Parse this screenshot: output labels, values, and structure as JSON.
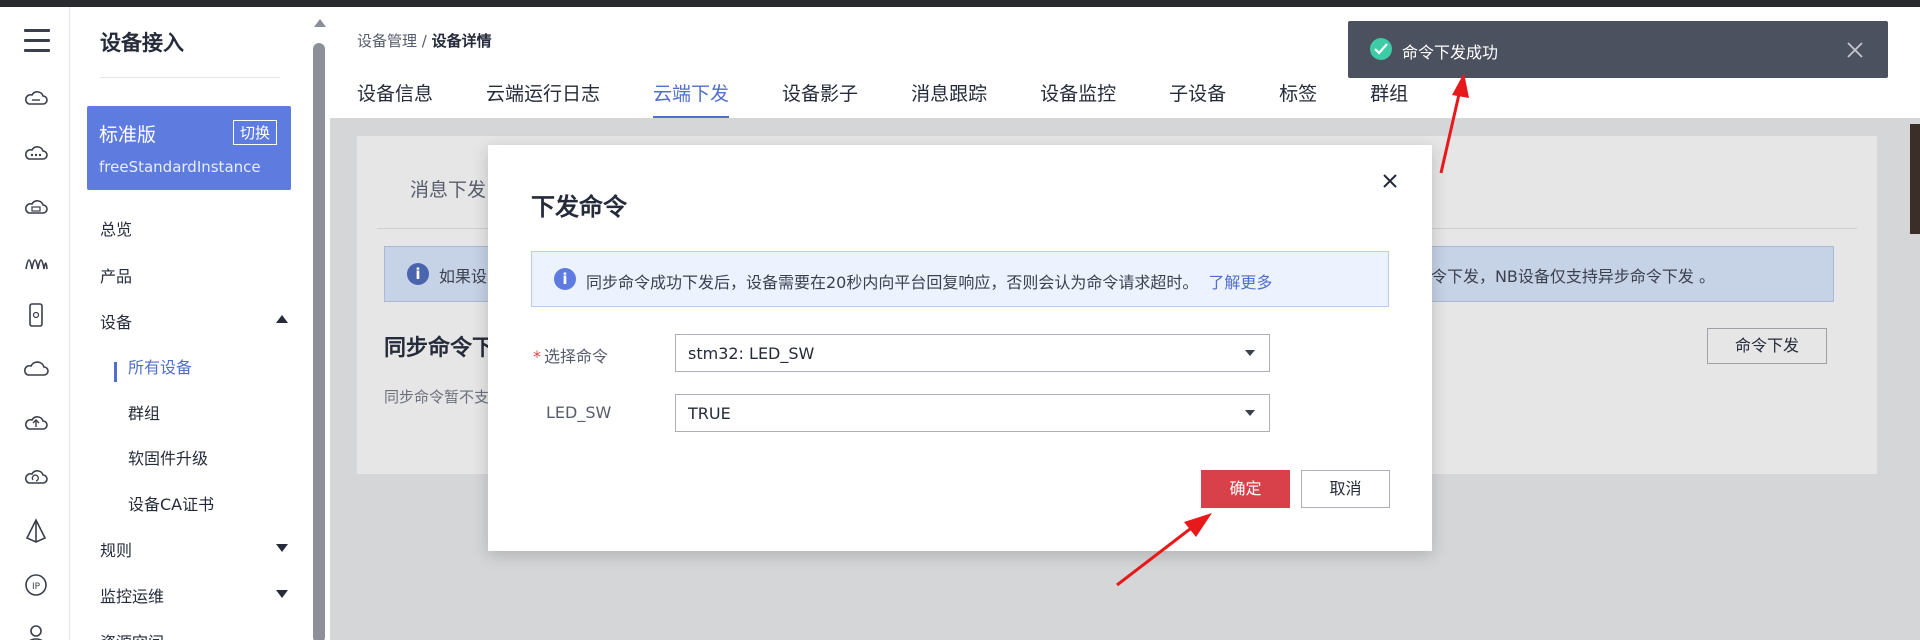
{
  "sidebar": {
    "title": "设备接入",
    "edition_name": "标准版",
    "edition_switch": "切换",
    "instance": "freeStandardInstance",
    "items": [
      {
        "label": "总览"
      },
      {
        "label": "产品"
      },
      {
        "label": "设备"
      },
      {
        "label": "规则"
      },
      {
        "label": "监控运维"
      },
      {
        "label": "资源空间"
      }
    ],
    "device_sub": [
      {
        "label": "所有设备"
      },
      {
        "label": "群组"
      },
      {
        "label": "软固件升级"
      },
      {
        "label": "设备CA证书"
      }
    ]
  },
  "breadcrumb": {
    "parent": "设备管理",
    "sep": "/",
    "current": "设备详情"
  },
  "tabs": [
    {
      "label": "设备信息"
    },
    {
      "label": "云端运行日志"
    },
    {
      "label": "云端下发"
    },
    {
      "label": "设备影子"
    },
    {
      "label": "消息跟踪"
    },
    {
      "label": "设备监控"
    },
    {
      "label": "子设备"
    },
    {
      "label": "标签"
    },
    {
      "label": "群组"
    }
  ],
  "card": {
    "subtab": "消息下发",
    "banner_left": "如果设",
    "banner_right": "令下发，NB设备仅支持异步命令下发 。",
    "section_title": "同步命令下",
    "note": "同步命令暂不支",
    "command_button": "命令下发"
  },
  "modal": {
    "title": "下发命令",
    "tip": "同步命令成功下发后，设备需要在20秒内向平台回复响应，否则会认为命令请求超时。",
    "tip_link": "了解更多",
    "required_mark": "*",
    "field_command_label": "选择命令",
    "field_command_value": "stm32: LED_SW",
    "field_param_label": "LED_SW",
    "field_param_value": "TRUE",
    "confirm": "确定",
    "cancel": "取消"
  },
  "toast": {
    "message": "命令下发成功"
  },
  "colors": {
    "accent": "#526ecc",
    "danger": "#d9414a",
    "success": "#3dcca6",
    "annotation": "#e8191b"
  }
}
